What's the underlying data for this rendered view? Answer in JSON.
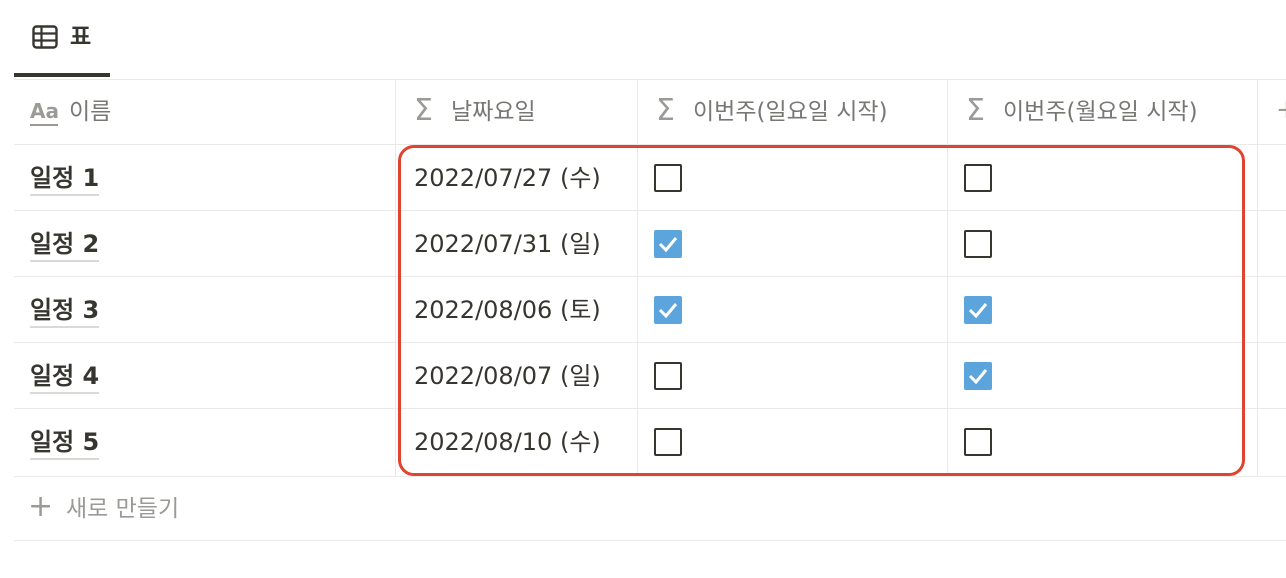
{
  "view_tab": {
    "label": "표",
    "icon": "table-icon"
  },
  "columns": [
    {
      "label": "이름",
      "icon": "text-property-icon"
    },
    {
      "label": "날짜요일",
      "icon": "formula-icon"
    },
    {
      "label": "이번주(일요일 시작)",
      "icon": "formula-icon"
    },
    {
      "label": "이번주(월요일 시작)",
      "icon": "formula-icon"
    }
  ],
  "rows": [
    {
      "name": "일정 1",
      "date": "2022/07/27 (수)",
      "sun_week": false,
      "mon_week": false
    },
    {
      "name": "일정 2",
      "date": "2022/07/31 (일)",
      "sun_week": true,
      "mon_week": false
    },
    {
      "name": "일정 3",
      "date": "2022/08/06 (토)",
      "sun_week": true,
      "mon_week": true
    },
    {
      "name": "일정 4",
      "date": "2022/08/07 (일)",
      "sun_week": false,
      "mon_week": true
    },
    {
      "name": "일정 5",
      "date": "2022/08/10 (수)",
      "sun_week": false,
      "mon_week": false
    }
  ],
  "new_row_label": "새로 만들기",
  "colors": {
    "checkbox_checked": "#5ba4dc",
    "highlight_border": "#e0432f"
  }
}
